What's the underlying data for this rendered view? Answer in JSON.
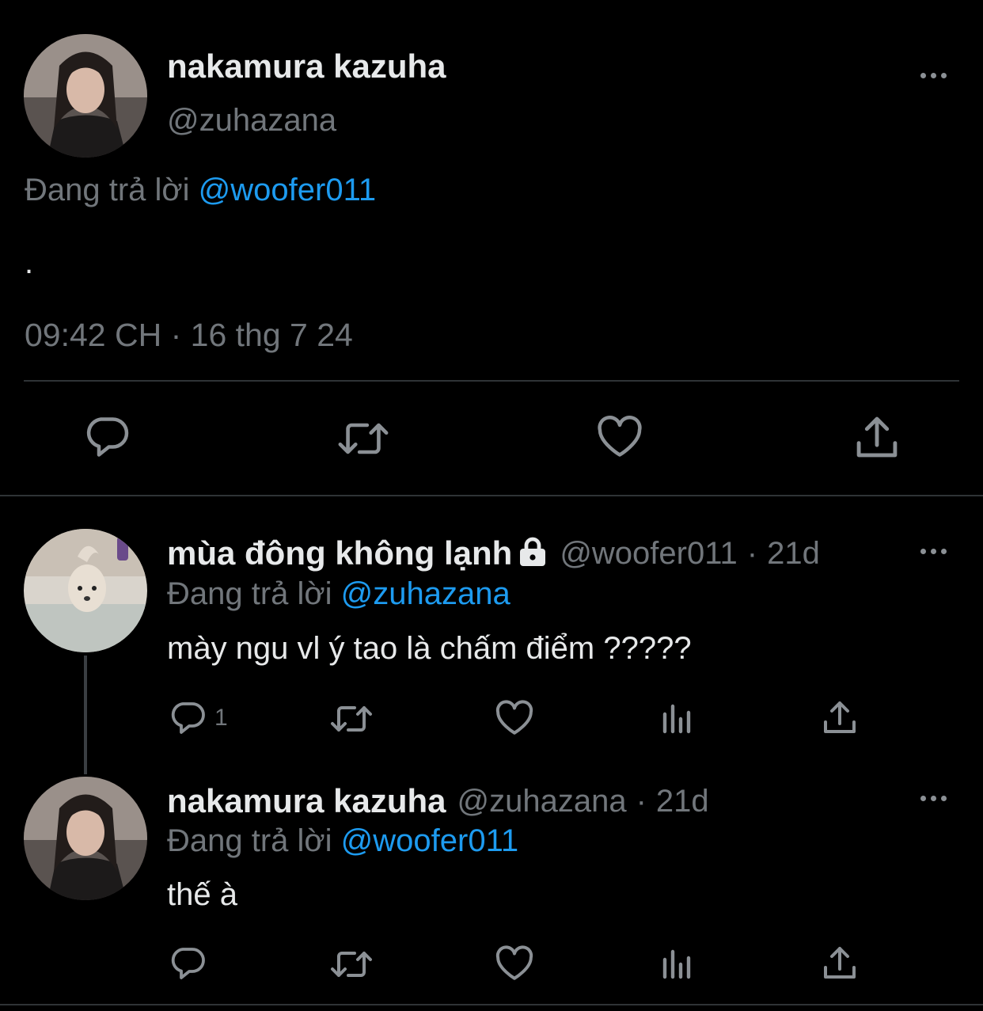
{
  "main_tweet": {
    "display_name": "nakamura kazuha",
    "handle": "@zuhazana",
    "reply_prefix": "Đang trả lời",
    "reply_to": "@woofer011",
    "text": ".",
    "timestamp": "09:42 CH · 16 thg 7 24"
  },
  "replies": [
    {
      "display_name": "mùa đông không lạnh",
      "protected": true,
      "handle": "@woofer011",
      "sep": "·",
      "age": "21d",
      "reply_prefix": "Đang trả lời",
      "reply_to": "@zuhazana",
      "text": "mày ngu vl ý tao là chấm điểm ?????",
      "reply_count": "1"
    },
    {
      "display_name": "nakamura kazuha",
      "handle": "@zuhazana",
      "sep": "·",
      "age": "21d",
      "reply_prefix": "Đang trả lời",
      "reply_to": "@woofer011",
      "text": "thế à",
      "reply_count": ""
    }
  ],
  "icons": {
    "reply": "reply-icon",
    "retweet": "retweet-icon",
    "like": "heart-icon",
    "views": "views-icon",
    "share": "share-icon",
    "more": "more-icon",
    "lock": "lock-icon"
  },
  "colors": {
    "background": "#000000",
    "text": "#e7e9ea",
    "secondary": "#71767b",
    "link": "#1d9bf0",
    "divider": "#2f3336"
  }
}
